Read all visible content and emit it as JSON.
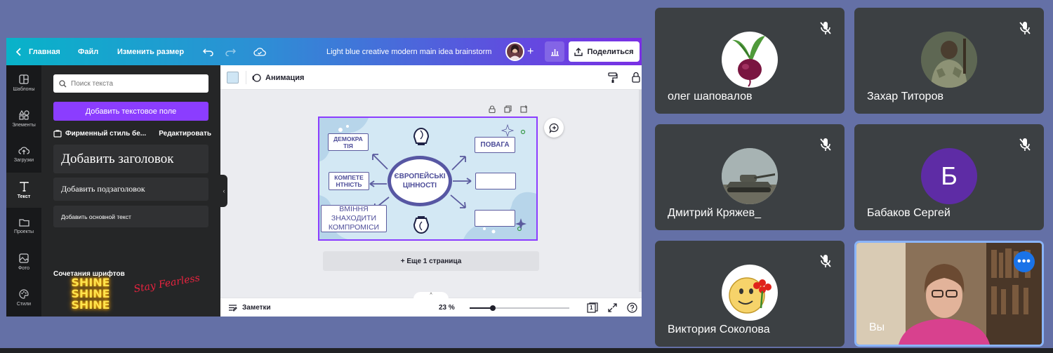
{
  "canva": {
    "topbar": {
      "home": "Главная",
      "file": "Файл",
      "resize": "Изменить размер",
      "title": "Light blue creative modern main idea brainstorm",
      "share": "Поделиться"
    },
    "rail": [
      {
        "label": "Шаблоны",
        "icon": "templates-icon"
      },
      {
        "label": "Элементы",
        "icon": "elements-icon"
      },
      {
        "label": "Загрузки",
        "icon": "uploads-icon"
      },
      {
        "label": "Текст",
        "icon": "text-icon"
      },
      {
        "label": "Проекты",
        "icon": "projects-icon"
      },
      {
        "label": "Фото",
        "icon": "photo-icon"
      },
      {
        "label": "Стили",
        "icon": "styles-icon"
      }
    ],
    "panel": {
      "search_placeholder": "Поиск текста",
      "add_textbox": "Добавить текстовое поле",
      "brand_style": "Фирменный стиль бе...",
      "edit": "Редактировать",
      "heading": "Добавить заголовок",
      "subheading": "Добавить подзаголовок",
      "body": "Добавить основной текст",
      "font_combos": "Сочетания шрифтов",
      "combo1": "SHINE SHINE SHINE",
      "combo2": "Stay Fearless"
    },
    "toolbar": {
      "animation": "Анимация",
      "swatch_color": "#cfe6f5"
    },
    "design": {
      "center": "ЄВРОПЕЙСЬКІ ЦІННОСТІ",
      "node_democracy": "ДЕМОКРА ТІЯ",
      "node_competence": "КОМПЕТЕ НТНІСТЬ",
      "node_compromise": "ВМІННЯ ЗНАХОДИТИ КОМПРОМІСИ",
      "node_respect": "ПОВАГА",
      "accent": "#5757a3",
      "background": "#d3e8f4"
    },
    "add_page": "+ Еще 1 страница",
    "bottom": {
      "notes": "Заметки",
      "zoom": "23 %",
      "zoom_fraction": 0.23,
      "page_count": "1"
    }
  },
  "participants": [
    {
      "name": "олег шаповалов",
      "muted": true,
      "avatar": "beet-avatar"
    },
    {
      "name": "Захар Титоров",
      "muted": true,
      "avatar": "soldier-avatar"
    },
    {
      "name": "Дмитрий Кряжев_",
      "muted": true,
      "avatar": "tank-avatar"
    },
    {
      "name": "Бабаков Сергей",
      "muted": true,
      "avatar": "letter-avatar",
      "initial": "Б",
      "color": "#5e2ca5"
    },
    {
      "name": "Виктория Соколова",
      "muted": true,
      "avatar": "smiley-flower-avatar"
    },
    {
      "name": "Вы",
      "muted": false,
      "avatar": "self-video"
    }
  ]
}
